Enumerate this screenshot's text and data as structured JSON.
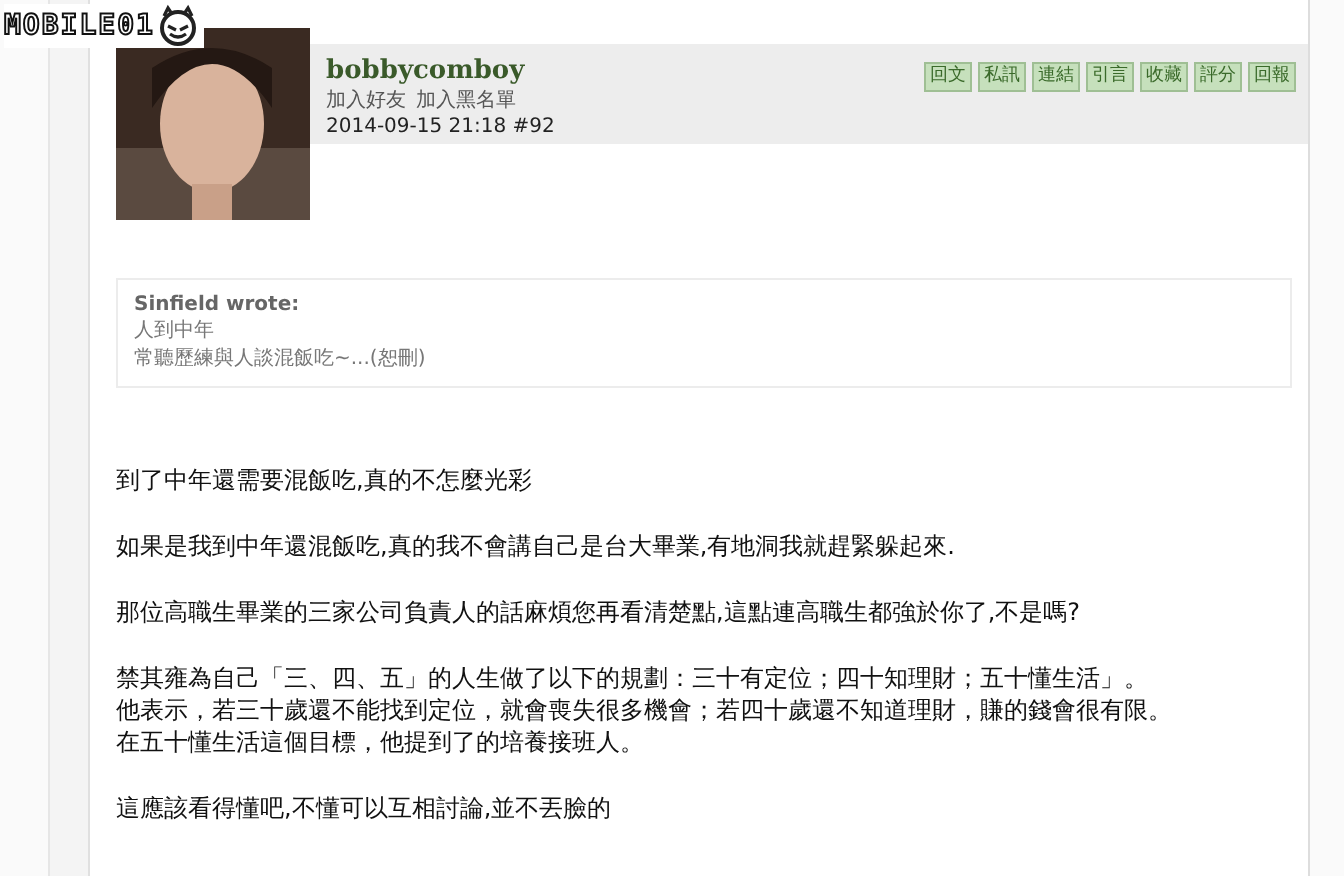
{
  "logo": "MOBILE01",
  "post": {
    "author": "bobbycomboy",
    "links": [
      "加入好友",
      "加入黑名單"
    ],
    "meta": "2014-09-15 21:18  #92",
    "actions": [
      "回文",
      "私訊",
      "連結",
      "引言",
      "收藏",
      "評分",
      "回報"
    ],
    "quote": {
      "header": "Sinfield wrote:",
      "lines": [
        "人到中年",
        "常聽歷練與人談混飯吃~...(恕刪)"
      ]
    },
    "paragraphs": [
      [
        "到了中年還需要混飯吃,真的不怎麼光彩"
      ],
      [
        "如果是我到中年還混飯吃,真的我不會講自己是台大畢業,有地洞我就趕緊躲起來."
      ],
      [
        "那位高職生畢業的三家公司負責人的話麻煩您再看清楚點,這點連高職生都強於你了,不是嗎?"
      ],
      [
        "禁其雍為自己「三、四、五」的人生做了以下的規劃：三十有定位；四十知理財；五十懂生活」。",
        "他表示，若三十歲還不能找到定位，就會喪失很多機會；若四十歲還不知道理財，賺的錢會很有限。",
        "在五十懂生活這個目標，他提到了的培養接班人。"
      ],
      [
        "這應該看得懂吧,不懂可以互相討論,並不丟臉的"
      ]
    ]
  }
}
